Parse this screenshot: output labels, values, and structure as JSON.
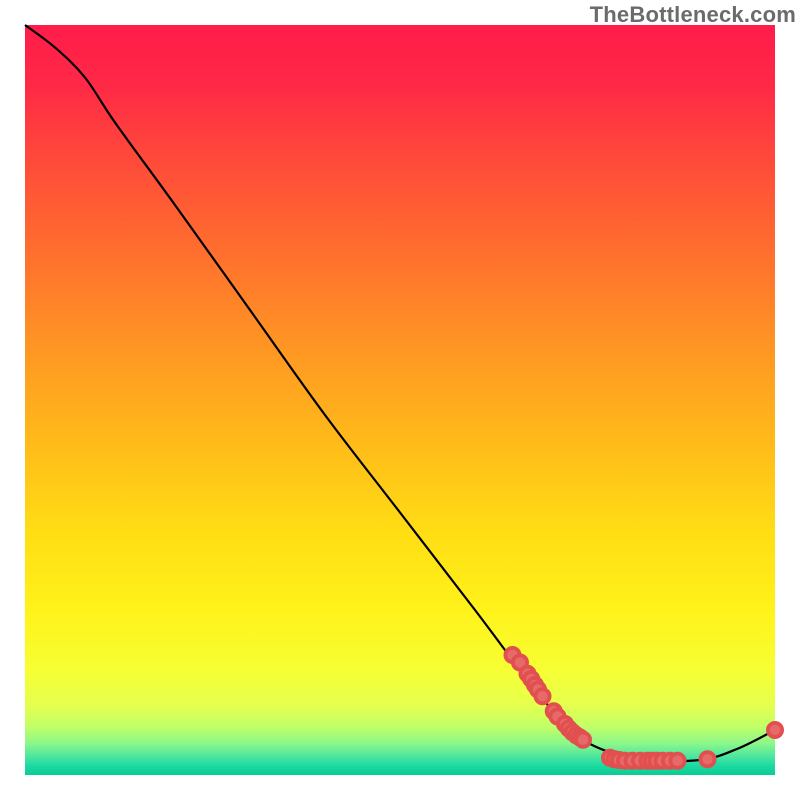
{
  "watermark": "TheBottleneck.com",
  "chart_data": {
    "type": "line",
    "title": "",
    "xlabel": "",
    "ylabel": "",
    "xlim": [
      0,
      100
    ],
    "ylim": [
      0,
      100
    ],
    "curve": [
      {
        "x": 0,
        "y": 100
      },
      {
        "x": 4,
        "y": 97
      },
      {
        "x": 8,
        "y": 93
      },
      {
        "x": 12,
        "y": 87
      },
      {
        "x": 20,
        "y": 76
      },
      {
        "x": 30,
        "y": 62
      },
      {
        "x": 40,
        "y": 48
      },
      {
        "x": 50,
        "y": 35
      },
      {
        "x": 60,
        "y": 22
      },
      {
        "x": 66,
        "y": 14
      },
      {
        "x": 70,
        "y": 9
      },
      {
        "x": 74,
        "y": 5
      },
      {
        "x": 78,
        "y": 3
      },
      {
        "x": 82,
        "y": 2
      },
      {
        "x": 90,
        "y": 2
      },
      {
        "x": 95,
        "y": 3.5
      },
      {
        "x": 100,
        "y": 6
      }
    ],
    "scatter": [
      {
        "x": 65,
        "y": 16
      },
      {
        "x": 66,
        "y": 15
      },
      {
        "x": 67,
        "y": 13.5
      },
      {
        "x": 67.5,
        "y": 12.8
      },
      {
        "x": 68,
        "y": 12
      },
      {
        "x": 68.4,
        "y": 11.4
      },
      {
        "x": 69,
        "y": 10.5
      },
      {
        "x": 70.5,
        "y": 8.5
      },
      {
        "x": 71,
        "y": 7.8
      },
      {
        "x": 72,
        "y": 6.8
      },
      {
        "x": 72.5,
        "y": 6.2
      },
      {
        "x": 73,
        "y": 5.7
      },
      {
        "x": 73.5,
        "y": 5.3
      },
      {
        "x": 74,
        "y": 5
      },
      {
        "x": 74.4,
        "y": 4.7
      },
      {
        "x": 78,
        "y": 2.3
      },
      {
        "x": 78.6,
        "y": 2.1
      },
      {
        "x": 79.2,
        "y": 2.0
      },
      {
        "x": 80,
        "y": 1.9
      },
      {
        "x": 81,
        "y": 1.9
      },
      {
        "x": 82,
        "y": 1.9
      },
      {
        "x": 83,
        "y": 1.9
      },
      {
        "x": 83.6,
        "y": 1.9
      },
      {
        "x": 84.2,
        "y": 1.9
      },
      {
        "x": 85,
        "y": 1.9
      },
      {
        "x": 86,
        "y": 1.9
      },
      {
        "x": 87,
        "y": 1.9
      },
      {
        "x": 91,
        "y": 2.1
      },
      {
        "x": 100,
        "y": 6
      }
    ],
    "gradient_stops": [
      {
        "offset": 0,
        "color": "#ff1c4a"
      },
      {
        "offset": 0.08,
        "color": "#ff2946"
      },
      {
        "offset": 0.18,
        "color": "#ff4a3a"
      },
      {
        "offset": 0.3,
        "color": "#ff6e2e"
      },
      {
        "offset": 0.42,
        "color": "#ff9324"
      },
      {
        "offset": 0.55,
        "color": "#ffb91a"
      },
      {
        "offset": 0.68,
        "color": "#ffde14"
      },
      {
        "offset": 0.78,
        "color": "#fff21a"
      },
      {
        "offset": 0.86,
        "color": "#f6ff33"
      },
      {
        "offset": 0.905,
        "color": "#e6ff4d"
      },
      {
        "offset": 0.935,
        "color": "#c2ff66"
      },
      {
        "offset": 0.958,
        "color": "#8cf78a"
      },
      {
        "offset": 0.975,
        "color": "#4de69e"
      },
      {
        "offset": 0.988,
        "color": "#1ad9a2"
      },
      {
        "offset": 1.0,
        "color": "#0acc90"
      }
    ]
  }
}
